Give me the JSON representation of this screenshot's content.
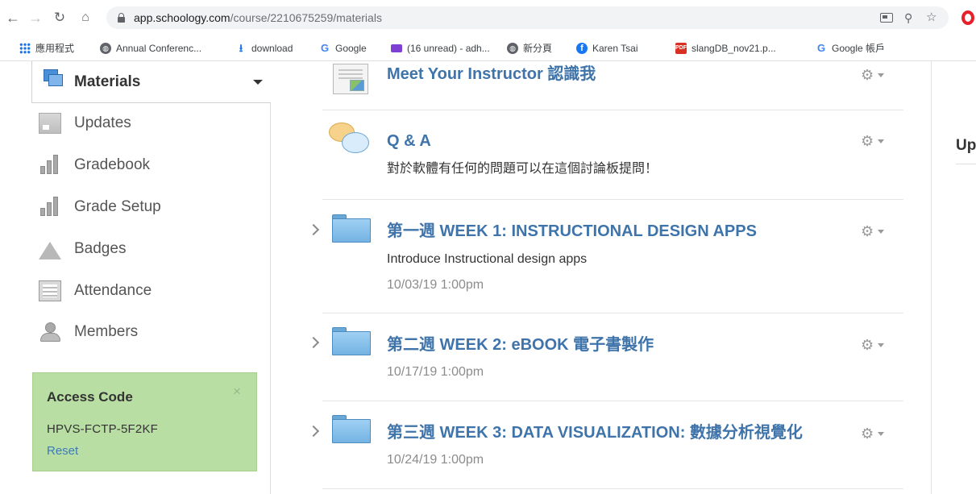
{
  "browser": {
    "url_host": "app.schoology.com",
    "url_path": "/course/2210675259/materials",
    "bookmarks": [
      {
        "label": "應用程式",
        "icon": "apps-grid-icon"
      },
      {
        "label": "Annual Conferenc...",
        "icon": "globe-icon"
      },
      {
        "label": "download",
        "icon": "download-icon"
      },
      {
        "label": "Google",
        "icon": "google-icon"
      },
      {
        "label": "(16 unread) - adh...",
        "icon": "mail-icon"
      },
      {
        "label": "新分頁",
        "icon": "globe-icon"
      },
      {
        "label": "Karen Tsai",
        "icon": "facebook-icon"
      },
      {
        "label": "slangDB_nov21.p...",
        "icon": "pdf-icon"
      },
      {
        "label": "Google 帳戶",
        "icon": "google-icon"
      }
    ]
  },
  "sidebar": {
    "active": {
      "label": "Materials",
      "icon": "materials-icon"
    },
    "items": [
      {
        "label": "Updates",
        "icon": "updates-icon"
      },
      {
        "label": "Gradebook",
        "icon": "gradebook-icon"
      },
      {
        "label": "Grade Setup",
        "icon": "grade-setup-icon"
      },
      {
        "label": "Badges",
        "icon": "badge-icon"
      },
      {
        "label": "Attendance",
        "icon": "attendance-icon"
      },
      {
        "label": "Members",
        "icon": "members-icon"
      }
    ],
    "access_code": {
      "title": "Access Code",
      "code": "HPVS-FCTP-5F2KF",
      "reset_label": "Reset",
      "close_glyph": "×"
    }
  },
  "materials": [
    {
      "title": "Meet Your Instructor 認識我",
      "icon": "page-icon"
    },
    {
      "title": "Q & A",
      "description": "對於軟體有任何的問題可以在這個討論板提問！",
      "icon": "discussion-icon"
    },
    {
      "title": "第一週 WEEK 1: INSTRUCTIONAL DESIGN APPS",
      "description": "Introduce Instructional design apps",
      "date": "10/03/19 1:00pm",
      "icon": "folder-icon"
    },
    {
      "title": "第二週 WEEK 2: eBOOK 電子書製作",
      "date": "10/17/19 1:00pm",
      "icon": "folder-icon"
    },
    {
      "title": "第三週 WEEK 3: DATA VISUALIZATION: 數據分析視覺化",
      "date": "10/24/19 1:00pm",
      "icon": "folder-icon"
    }
  ],
  "right_panel": {
    "heading_fragment": "Up"
  },
  "colors": {
    "link_blue": "#3f74aa",
    "access_green": "#b9dea4",
    "reset_link": "#3d7ab8"
  }
}
